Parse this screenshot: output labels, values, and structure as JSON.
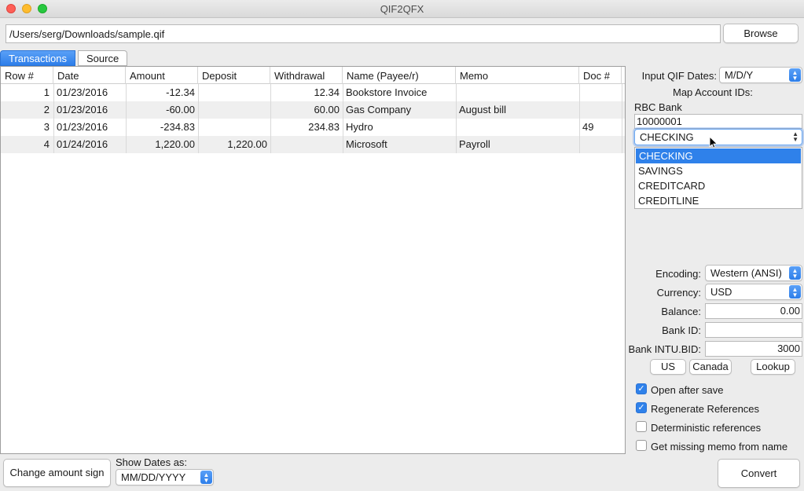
{
  "window": {
    "title": "QIF2QFX"
  },
  "file": {
    "path": "/Users/serg/Downloads/sample.qif",
    "browse_label": "Browse"
  },
  "tabs": [
    "Transactions",
    "Source"
  ],
  "table": {
    "columns": [
      "Row #",
      "Date",
      "Amount",
      "Deposit",
      "Withdrawal",
      "Name (Payee/r)",
      "Memo",
      "Doc #"
    ],
    "rows": [
      [
        "1",
        "01/23/2016",
        "-12.34",
        "",
        "12.34",
        "Bookstore Invoice",
        "",
        ""
      ],
      [
        "2",
        "01/23/2016",
        "-60.00",
        "",
        "60.00",
        "Gas Company",
        "August bill",
        ""
      ],
      [
        "3",
        "01/23/2016",
        "-234.83",
        "",
        "234.83",
        "Hydro",
        "",
        "49"
      ],
      [
        "4",
        "01/24/2016",
        "1,220.00",
        "1,220.00",
        "",
        "Microsoft",
        "Payroll",
        ""
      ]
    ]
  },
  "side": {
    "input_dates_label": "Input QIF Dates:",
    "input_dates_value": "M/D/Y",
    "map_label": "Map Account IDs:",
    "bank_name": "RBC Bank",
    "account_id": "10000001",
    "account_type": "CHECKING",
    "account_type_options": [
      "CHECKING",
      "SAVINGS",
      "CREDITCARD",
      "CREDITLINE"
    ],
    "encoding_label": "Encoding:",
    "encoding_value": "Western (ANSI)",
    "currency_label": "Currency:",
    "currency_value": "USD",
    "balance_label": "Balance:",
    "balance_value": "0.00",
    "bank_id_label": "Bank ID:",
    "bank_id_value": "",
    "intu_label": "Bank INTU.BID:",
    "intu_value": "3000",
    "us_label": "US",
    "canada_label": "Canada",
    "lookup_label": "Lookup",
    "options": [
      {
        "label": "Open after save",
        "checked": true
      },
      {
        "label": "Regenerate References",
        "checked": true
      },
      {
        "label": "Deterministic references",
        "checked": false
      },
      {
        "label": "Get missing memo from name",
        "checked": false
      }
    ]
  },
  "bottom": {
    "change_sign_label": "Change amount sign",
    "show_dates_label": "Show Dates as:",
    "show_dates_value": "MM/DD/YYYY",
    "convert_label": "Convert"
  },
  "colors": {
    "accent": "#2f81ea",
    "close": "#fe5f57",
    "minimize": "#febc2e",
    "zoom": "#28c840"
  }
}
